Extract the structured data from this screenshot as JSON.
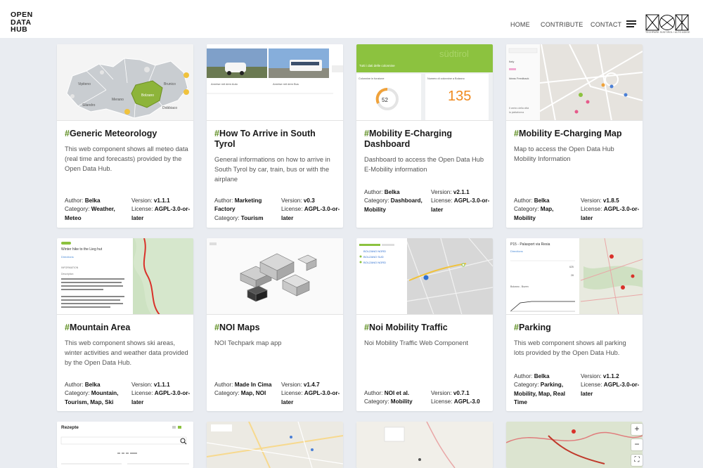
{
  "header": {
    "logo": [
      "OPEN",
      "DATA",
      "HUB"
    ],
    "nav": [
      {
        "label": "HOME"
      },
      {
        "label": "CONTRIBUTE"
      },
      {
        "label": "CONTACT"
      }
    ],
    "noi_caption": "TECHPARK SÜDTIROL / ALTO ADIGE"
  },
  "cards": [
    {
      "title": "Generic Meteorology",
      "desc": "This web component shows all meteo data (real time and forecasts) provided by the Open Data Hub.",
      "author_label": "Author:",
      "author": "Belka",
      "category_label": "Category:",
      "category": "Weather, Meteo",
      "version_label": "Version:",
      "version": "v1.1.1",
      "license_label": "License:",
      "license": "AGPL-3.0-or-later",
      "thumb_labels": [
        "Vipiteno",
        "Brunico",
        "Merano",
        "Silandro",
        "Bolzano",
        "Dobbiaco"
      ]
    },
    {
      "title": "How To Arrive in South Tyrol",
      "desc": "General informations on how to arrive in South Tyrol by car, train, bus or with the airplane",
      "author_label": "Author:",
      "author": "Marketing Factory",
      "category_label": "Category:",
      "category": "Tourism",
      "version_label": "Version:",
      "version": "v0.3",
      "license_label": "License:",
      "license": "AGPL-3.0-or-later",
      "thumb_labels": [
        "Anreise mit dem Auto",
        "Anreise mit dem Bus"
      ]
    },
    {
      "title": "Mobility E-Charging Dashboard",
      "desc": "Dashboard to access the Open Data Hub E-Mobility information",
      "author_label": "Author:",
      "author": "Belka",
      "category_label": "Category:",
      "category": "Dashboard, Mobility",
      "version_label": "Version:",
      "version": "v2.1.1",
      "license_label": "License:",
      "license": "AGPL-3.0-or-later",
      "thumb_labels": [
        "Tutti i dati delle colonnine",
        "Colonnine in funzione",
        "Numero di colonnine a Bolzano",
        "52",
        "135",
        "südtirol"
      ]
    },
    {
      "title": "Mobility E-Charging Map",
      "desc": "Map to access the Open Data Hub Mobility Information",
      "author_label": "Author:",
      "author": "Belka",
      "category_label": "Category:",
      "category": "Map, Mobility",
      "version_label": "Version:",
      "version": "v1.8.5",
      "license_label": "License:",
      "license": "AGPL-3.0-or-later",
      "thumb_labels": [
        "Italy",
        "Ideas Feedback",
        "Il centro della città",
        "la piattaforma"
      ]
    },
    {
      "title": "Mountain Area",
      "desc": "This web component shows ski areas, winter activities and weather data provided by the Open Data Hub.",
      "author_label": "Author:",
      "author": "Belka",
      "category_label": "Category:",
      "category": "Mountain, Tourism, Map, Ski",
      "version_label": "Version:",
      "version": "v1.1.1",
      "license_label": "License:",
      "license": "AGPL-3.0-or-later",
      "thumb_labels": [
        "Winter hike to the Lieg hut",
        "Directions",
        "INFORMATION",
        "Description"
      ]
    },
    {
      "title": "NOI Maps",
      "desc": "NOI Techpark map app",
      "author_label": "Author:",
      "author": "Made In Cima",
      "category_label": "Category:",
      "category": "Map, NOI",
      "version_label": "Version:",
      "version": "v1.4.7",
      "license_label": "License:",
      "license": "AGPL-3.0-or-later",
      "thumb_labels": []
    },
    {
      "title": "Noi Mobility Traffic",
      "desc": "Noi Mobility Traffic Web Component",
      "author_label": "Author:",
      "author": "NOI et al.",
      "category_label": "Category:",
      "category": "Mobility",
      "version_label": "Version:",
      "version": "v0.7.1",
      "license_label": "License:",
      "license": "AGPL-3.0",
      "thumb_labels": [
        "BOLZANO NORD",
        "BOLZANO SUD",
        "BOLZANO NORD"
      ]
    },
    {
      "title": "Parking",
      "desc": "This web component shows all parking lots provided by the Open Data Hub.",
      "author_label": "Author:",
      "author": "Belka",
      "category_label": "Category:",
      "category": "Parking, Mobility, Map, Real Time",
      "version_label": "Version:",
      "version": "v1.1.2",
      "license_label": "License:",
      "license": "AGPL-3.0-or-later",
      "thumb_labels": [
        "P15 - Palasport via Resia",
        "Directions",
        "625",
        "28",
        "Bolzano - Bozen"
      ]
    }
  ],
  "bottom_cards": [
    {
      "thumb_label": "Rezepte"
    },
    {
      "thumb_label": ""
    },
    {
      "thumb_label": ""
    },
    {
      "thumb_label": ""
    }
  ],
  "map_controls": {
    "zoom_in": "+",
    "zoom_out": "−"
  },
  "colors": {
    "accent": "#5b8c1d",
    "background": "#e9ecf1"
  }
}
